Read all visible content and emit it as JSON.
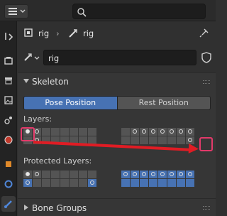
{
  "header": {
    "search_placeholder": ""
  },
  "context": {
    "object_name": "rig",
    "data_name": "rig"
  },
  "datablock": {
    "name": "rig"
  },
  "skeleton_panel": {
    "title": "Skeleton",
    "pose_position_label": "Pose Position",
    "rest_position_label": "Rest Position",
    "pose_mode_active": "Pose Position",
    "layers_label": "Layers:",
    "protected_layers_label": "Protected Layers:"
  },
  "bone_groups_panel": {
    "title": "Bone Groups"
  },
  "colors": {
    "accent": "#4772b3",
    "highlight": "#e33a6a",
    "arrow": "#e01c24"
  },
  "layers": {
    "group_a_row1": [
      "filled",
      "off",
      "none",
      "none",
      "none",
      "none",
      "none",
      "none"
    ],
    "group_a_row2": [
      "none",
      "off",
      "none",
      "none",
      "none",
      "none",
      "none",
      "none"
    ],
    "group_b_row1": [
      "none",
      "off",
      "off",
      "off",
      "off",
      "off",
      "off",
      "off"
    ],
    "group_b_row2": [
      "none",
      "none",
      "none",
      "none",
      "none",
      "none",
      "none",
      "off"
    ]
  },
  "protected_layers": {
    "group_a_row1": [
      "filled",
      "off",
      "none",
      "none",
      "none",
      "none",
      "none",
      "none"
    ],
    "group_a_row2": [
      "blue-off",
      "none",
      "none",
      "none",
      "none",
      "none",
      "none",
      "blue-off"
    ],
    "group_b_row1": [
      "blue-off",
      "blue-off",
      "blue-off",
      "blue-off",
      "blue-off",
      "blue-off",
      "blue-off",
      "blue-off"
    ],
    "group_b_row2": [
      "blue",
      "blue",
      "blue",
      "blue",
      "blue",
      "blue",
      "blue",
      "blue"
    ]
  }
}
